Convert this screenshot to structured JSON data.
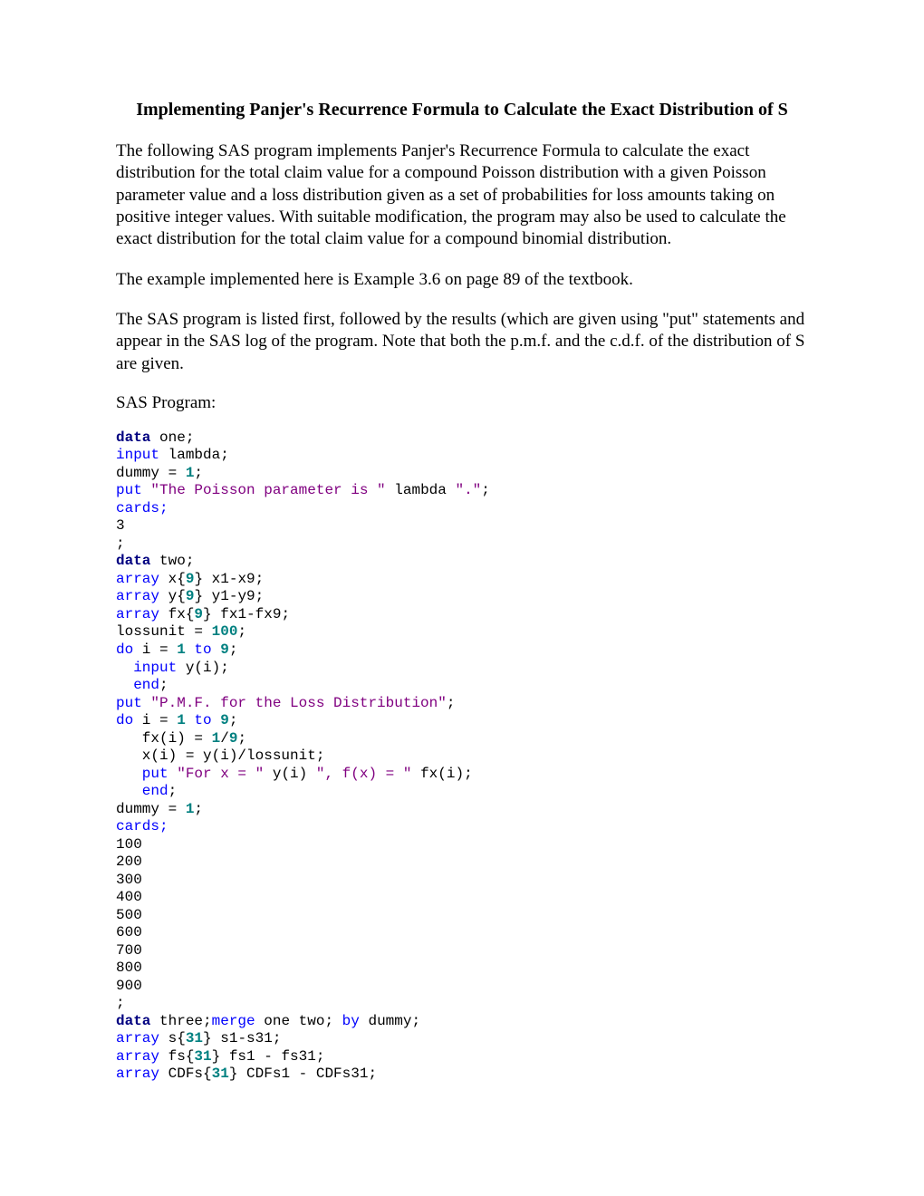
{
  "title": "Implementing Panjer's Recurrence Formula to Calculate the Exact Distribution of S",
  "para1": "The following SAS program implements Panjer's Recurrence Formula to calculate the exact distribution for the total claim value for a compound Poisson distribution with a given Poisson parameter value and a loss distribution given as a set of probabilities for loss amounts taking on positive integer values.  With suitable modification, the program may also be used to calculate the exact distribution for the total claim value for a compound binomial distribution.",
  "para2": "The example implemented here is Example 3.6 on page 89 of the textbook.",
  "para3": "The SAS program is listed first, followed by the results (which are given using \"put\" statements and appear in the SAS log of the program.  Note that both the p.m.f. and the c.d.f. of the distribution of S are given.",
  "label": "SAS Program:",
  "code": {
    "l1a": "data",
    "l1b": " one;",
    "l2a": "input",
    "l2b": " lambda;",
    "l3a": "dummy = ",
    "l3b": "1",
    "l3c": ";",
    "l4a": "put ",
    "l4b": "\"The Poisson parameter is \"",
    "l4c": " lambda ",
    "l4d": "\".\"",
    "l4e": ";",
    "l5": "cards;",
    "l6": "3",
    "l7": ";",
    "l8a": "data",
    "l8b": " two;",
    "l9a": "array",
    "l9b": " x{",
    "l9c": "9",
    "l9d": "} x1-x9;",
    "l10a": "array",
    "l10b": " y{",
    "l10c": "9",
    "l10d": "} y1-y9;",
    "l11a": "array",
    "l11b": " fx{",
    "l11c": "9",
    "l11d": "} fx1-fx9;",
    "l12a": "lossunit = ",
    "l12b": "100",
    "l12c": ";",
    "l13a": "do",
    "l13b": " i = ",
    "l13c": "1",
    "l13d": " to ",
    "l13e": "9",
    "l13f": ";",
    "l14a": "  input",
    "l14b": " y(i);",
    "l15a": "  end",
    "l15b": ";",
    "l16a": "put ",
    "l16b": "\"P.M.F. for the Loss Distribution\"",
    "l16c": ";",
    "l17a": "do",
    "l17b": " i = ",
    "l17c": "1",
    "l17d": " to ",
    "l17e": "9",
    "l17f": ";",
    "l18a": "   fx(i) = ",
    "l18b": "1",
    "l18c": "/",
    "l18d": "9",
    "l18e": ";",
    "l19": "   x(i) = y(i)/lossunit;",
    "l20a": "   put ",
    "l20b": "\"For x = \"",
    "l20c": " y(i) ",
    "l20d": "\", f(x) = \"",
    "l20e": " fx(i);",
    "l21a": "   end",
    "l21b": ";",
    "l22a": "dummy = ",
    "l22b": "1",
    "l22c": ";",
    "l23": "cards;",
    "l24": "100",
    "l25": "200",
    "l26": "300",
    "l27": "400",
    "l28": "500",
    "l29": "600",
    "l30": "700",
    "l31": "800",
    "l32": "900",
    "l33": ";",
    "l34a": "data",
    "l34b": " three;",
    "l34c": "merge",
    "l34d": " one two; ",
    "l34e": "by",
    "l34f": " dummy;",
    "l35a": "array",
    "l35b": " s{",
    "l35c": "31",
    "l35d": "} s1-s31;",
    "l36a": "array",
    "l36b": " fs{",
    "l36c": "31",
    "l36d": "} fs1 - fs31;",
    "l37a": "array",
    "l37b": " CDFs{",
    "l37c": "31",
    "l37d": "} CDFs1 - CDFs31;"
  }
}
